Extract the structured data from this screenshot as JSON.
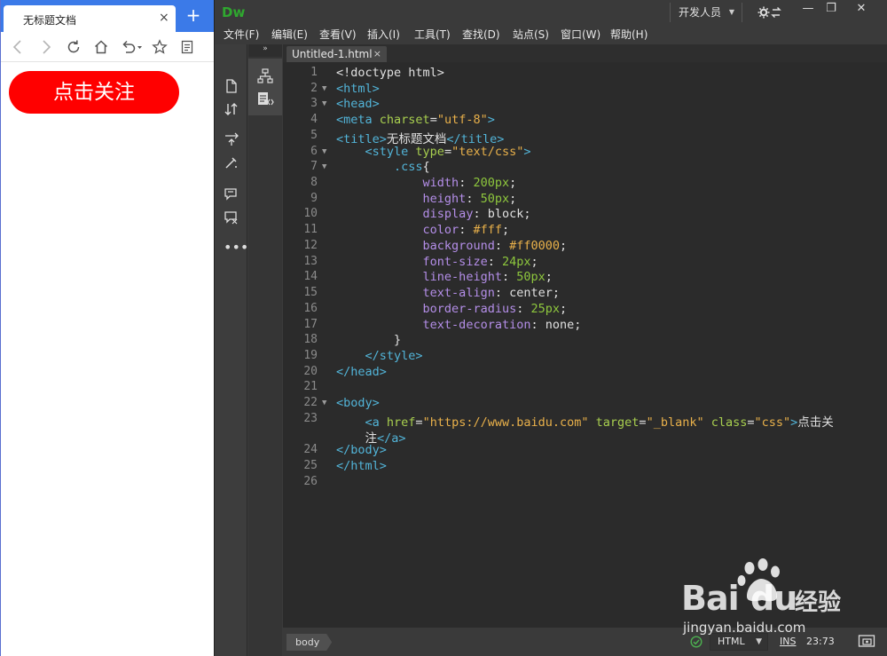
{
  "browser": {
    "tab_title": "无标题文档",
    "tab_close": "×",
    "new_tab": "+",
    "page_button_label": "点击关注",
    "page_button_color": "#ff0000",
    "page_button_href": "https://www.baidu.com"
  },
  "dw": {
    "logo": "Dw",
    "workspace": "开发人员",
    "win_min": "—",
    "win_max": "❐",
    "win_close": "✕",
    "menu": [
      "文件(F)",
      "编辑(E)",
      "查看(V)",
      "插入(I)",
      "工具(T)",
      "查找(D)",
      "站点(S)",
      "窗口(W)",
      "帮助(H)"
    ],
    "panel_collapse": "»",
    "document_tab": "Untitled-1.html",
    "document_tab_close": "×",
    "code_lines": [
      {
        "n": "1",
        "fold": "",
        "tokens": [
          {
            "t": "plain",
            "v": "<!doctype html>"
          }
        ]
      },
      {
        "n": "2",
        "fold": "▼",
        "tokens": [
          {
            "t": "tag",
            "v": "<html>"
          }
        ]
      },
      {
        "n": "3",
        "fold": "▼",
        "tokens": [
          {
            "t": "tag",
            "v": "<head>"
          }
        ]
      },
      {
        "n": "4",
        "fold": "",
        "tokens": [
          {
            "t": "tag",
            "v": "<meta "
          },
          {
            "t": "attr",
            "v": "charset"
          },
          {
            "t": "plain",
            "v": "="
          },
          {
            "t": "str",
            "v": "\"utf-8\""
          },
          {
            "t": "tag",
            "v": ">"
          }
        ]
      },
      {
        "n": "5",
        "fold": "",
        "tokens": [
          {
            "t": "tag",
            "v": "<title>"
          },
          {
            "t": "plain",
            "v": "无标题文档"
          },
          {
            "t": "tag",
            "v": "</title>"
          }
        ]
      },
      {
        "n": "6",
        "fold": "▼",
        "tokens": [
          {
            "t": "plain",
            "v": "    "
          },
          {
            "t": "tag",
            "v": "<style "
          },
          {
            "t": "attr",
            "v": "type"
          },
          {
            "t": "plain",
            "v": "="
          },
          {
            "t": "str",
            "v": "\"text/css\""
          },
          {
            "t": "tag",
            "v": ">"
          }
        ]
      },
      {
        "n": "7",
        "fold": "▼",
        "tokens": [
          {
            "t": "plain",
            "v": "        "
          },
          {
            "t": "sel",
            "v": ".css"
          },
          {
            "t": "plain",
            "v": "{"
          }
        ]
      },
      {
        "n": "8",
        "fold": "",
        "tokens": [
          {
            "t": "plain",
            "v": "            "
          },
          {
            "t": "prop",
            "v": "width"
          },
          {
            "t": "plain",
            "v": ": "
          },
          {
            "t": "num",
            "v": "200px"
          },
          {
            "t": "plain",
            "v": ";"
          }
        ]
      },
      {
        "n": "9",
        "fold": "",
        "tokens": [
          {
            "t": "plain",
            "v": "            "
          },
          {
            "t": "prop",
            "v": "height"
          },
          {
            "t": "plain",
            "v": ": "
          },
          {
            "t": "num",
            "v": "50px"
          },
          {
            "t": "plain",
            "v": ";"
          }
        ]
      },
      {
        "n": "10",
        "fold": "",
        "tokens": [
          {
            "t": "plain",
            "v": "            "
          },
          {
            "t": "prop",
            "v": "display"
          },
          {
            "t": "plain",
            "v": ": "
          },
          {
            "t": "val",
            "v": "block"
          },
          {
            "t": "plain",
            "v": ";"
          }
        ]
      },
      {
        "n": "11",
        "fold": "",
        "tokens": [
          {
            "t": "plain",
            "v": "            "
          },
          {
            "t": "prop",
            "v": "color"
          },
          {
            "t": "plain",
            "v": ": "
          },
          {
            "t": "hex",
            "v": "#fff"
          },
          {
            "t": "plain",
            "v": ";"
          }
        ]
      },
      {
        "n": "12",
        "fold": "",
        "tokens": [
          {
            "t": "plain",
            "v": "            "
          },
          {
            "t": "prop",
            "v": "background"
          },
          {
            "t": "plain",
            "v": ": "
          },
          {
            "t": "hex",
            "v": "#ff0000"
          },
          {
            "t": "plain",
            "v": ";"
          }
        ]
      },
      {
        "n": "13",
        "fold": "",
        "tokens": [
          {
            "t": "plain",
            "v": "            "
          },
          {
            "t": "prop",
            "v": "font-size"
          },
          {
            "t": "plain",
            "v": ": "
          },
          {
            "t": "num",
            "v": "24px"
          },
          {
            "t": "plain",
            "v": ";"
          }
        ]
      },
      {
        "n": "14",
        "fold": "",
        "tokens": [
          {
            "t": "plain",
            "v": "            "
          },
          {
            "t": "prop",
            "v": "line-height"
          },
          {
            "t": "plain",
            "v": ": "
          },
          {
            "t": "num",
            "v": "50px"
          },
          {
            "t": "plain",
            "v": ";"
          }
        ]
      },
      {
        "n": "15",
        "fold": "",
        "tokens": [
          {
            "t": "plain",
            "v": "            "
          },
          {
            "t": "prop",
            "v": "text-align"
          },
          {
            "t": "plain",
            "v": ": "
          },
          {
            "t": "val",
            "v": "center"
          },
          {
            "t": "plain",
            "v": ";"
          }
        ]
      },
      {
        "n": "16",
        "fold": "",
        "tokens": [
          {
            "t": "plain",
            "v": "            "
          },
          {
            "t": "prop",
            "v": "border-radius"
          },
          {
            "t": "plain",
            "v": ": "
          },
          {
            "t": "num",
            "v": "25px"
          },
          {
            "t": "plain",
            "v": ";"
          }
        ]
      },
      {
        "n": "17",
        "fold": "",
        "tokens": [
          {
            "t": "plain",
            "v": "            "
          },
          {
            "t": "prop",
            "v": "text-decoration"
          },
          {
            "t": "plain",
            "v": ": "
          },
          {
            "t": "val",
            "v": "none"
          },
          {
            "t": "plain",
            "v": ";"
          }
        ]
      },
      {
        "n": "18",
        "fold": "",
        "tokens": [
          {
            "t": "plain",
            "v": "        }"
          }
        ]
      },
      {
        "n": "19",
        "fold": "",
        "tokens": [
          {
            "t": "plain",
            "v": "    "
          },
          {
            "t": "tag",
            "v": "</style>"
          }
        ]
      },
      {
        "n": "20",
        "fold": "",
        "tokens": [
          {
            "t": "tag",
            "v": "</head>"
          }
        ]
      },
      {
        "n": "21",
        "fold": "",
        "tokens": []
      },
      {
        "n": "22",
        "fold": "▼",
        "tokens": [
          {
            "t": "tag",
            "v": "<body>"
          }
        ]
      },
      {
        "n": "23",
        "fold": "",
        "tokens": [
          {
            "t": "plain",
            "v": "    "
          },
          {
            "t": "tag",
            "v": "<a "
          },
          {
            "t": "attr",
            "v": "href"
          },
          {
            "t": "plain",
            "v": "="
          },
          {
            "t": "str",
            "v": "\"https://www.baidu.com\""
          },
          {
            "t": "plain",
            "v": " "
          },
          {
            "t": "attr",
            "v": "target"
          },
          {
            "t": "plain",
            "v": "="
          },
          {
            "t": "str",
            "v": "\"_blank\""
          },
          {
            "t": "plain",
            "v": " "
          },
          {
            "t": "attr",
            "v": "class"
          },
          {
            "t": "plain",
            "v": "="
          },
          {
            "t": "str",
            "v": "\"css\""
          },
          {
            "t": "tag",
            "v": ">"
          },
          {
            "t": "plain",
            "v": "点击关"
          }
        ]
      },
      {
        "n": "",
        "fold": "",
        "tokens": [
          {
            "t": "plain",
            "v": "    注"
          },
          {
            "t": "tag",
            "v": "</a>"
          }
        ]
      },
      {
        "n": "24",
        "fold": "",
        "tokens": [
          {
            "t": "tag",
            "v": "</body>"
          }
        ]
      },
      {
        "n": "25",
        "fold": "",
        "tokens": [
          {
            "t": "tag",
            "v": "</html>"
          }
        ]
      },
      {
        "n": "26",
        "fold": "",
        "tokens": []
      }
    ],
    "status": {
      "breadcrumb": "body",
      "language": "HTML",
      "mode": "INS",
      "cursor": "23:73"
    }
  },
  "watermark": {
    "brand": "Bai",
    "brand_tail": "du",
    "cn": "经验",
    "url": "jingyan.baidu.com"
  }
}
